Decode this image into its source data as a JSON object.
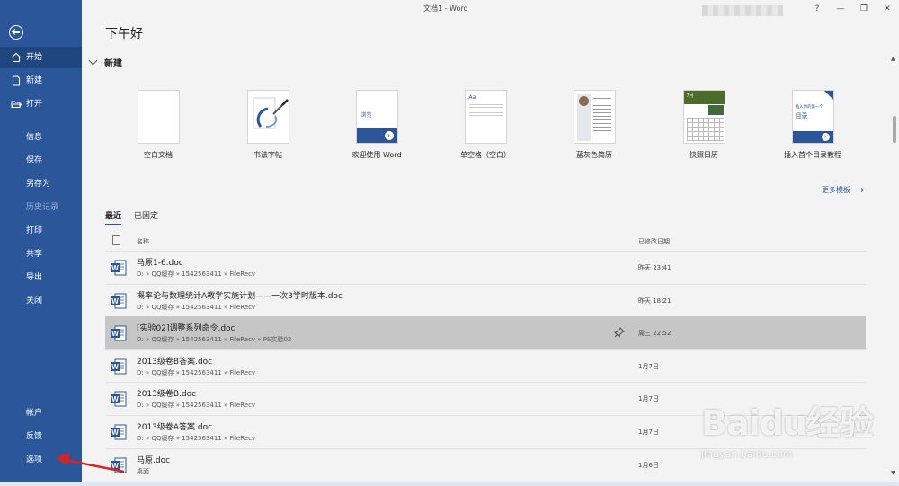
{
  "window": {
    "title": "文档1 - Word"
  },
  "sidebar": {
    "items": [
      {
        "label": "开始",
        "icon": "home-icon",
        "state": "active"
      },
      {
        "label": "新建",
        "icon": "new-document-icon",
        "state": "normal"
      },
      {
        "label": "打开",
        "icon": "open-folder-icon",
        "state": "normal"
      },
      {
        "label": "信息",
        "state": "normal"
      },
      {
        "label": "保存",
        "state": "normal"
      },
      {
        "label": "另存为",
        "state": "normal"
      },
      {
        "label": "历史记录",
        "state": "disabled"
      },
      {
        "label": "打印",
        "state": "normal"
      },
      {
        "label": "共享",
        "state": "normal"
      },
      {
        "label": "导出",
        "state": "normal"
      },
      {
        "label": "关闭",
        "state": "normal"
      },
      {
        "label": "帐户",
        "state": "normal"
      },
      {
        "label": "反馈",
        "state": "normal"
      },
      {
        "label": "选项",
        "state": "normal"
      }
    ]
  },
  "main": {
    "greeting": "下午好",
    "new_section": {
      "title": "新建",
      "more_label": "更多模板"
    },
    "templates": [
      {
        "label": "空白文档"
      },
      {
        "label": "书法字帖"
      },
      {
        "label": "欢迎使用 Word",
        "card_text": "浏览"
      },
      {
        "label": "单空格（空白）",
        "card_text": "Aa"
      },
      {
        "label": "蓝灰色简历"
      },
      {
        "label": "快照日历",
        "card_text": "7月"
      },
      {
        "label": "插入首个目录教程",
        "card_text": "插入你的第一个",
        "card_text2": "目录"
      }
    ],
    "tabs": [
      {
        "label": "最近",
        "active": true
      },
      {
        "label": "已固定",
        "active": false
      }
    ],
    "list_header": {
      "name": "名称",
      "date": "已修改日期"
    },
    "files": [
      {
        "name": "马原1-6.doc",
        "path": "D: » QQ缓存 » 1542563411 » FileRecv",
        "date": "昨天 23:41"
      },
      {
        "name": "概率论与数理统计A教学实施计划——一次3学时版本.doc",
        "path": "D: » QQ缓存 » 1542563411 » FileRecv",
        "date": "昨天 18:21"
      },
      {
        "name": "[实验02]调整系列命令.doc",
        "path": "D: » QQ缓存 » 1542563411 » FileRecv » PS实验02",
        "date": "周三 22:52",
        "selected": true
      },
      {
        "name": "2013级卷B答案.doc",
        "path": "D: » QQ缓存 » 1542563411 » FileRecv",
        "date": "1月7日"
      },
      {
        "name": "2013级卷B.doc",
        "path": "D: » QQ缓存 » 1542563411 » FileRecv",
        "date": "1月7日"
      },
      {
        "name": "2013级卷A答案.doc",
        "path": "D: » QQ缓存 » 1542563411 » FileRecv",
        "date": "1月7日"
      },
      {
        "name": "马原.doc",
        "path": "桌面",
        "date": "1月6日"
      }
    ]
  },
  "watermark": {
    "brand": "Baidu经验",
    "url": "jingyan.baidu.com"
  },
  "colors": {
    "sidebar": "#2b579a",
    "sidebar_active": "#1f467f",
    "selected_row": "#c6c6c6",
    "annotation_arrow": "#e02020"
  }
}
